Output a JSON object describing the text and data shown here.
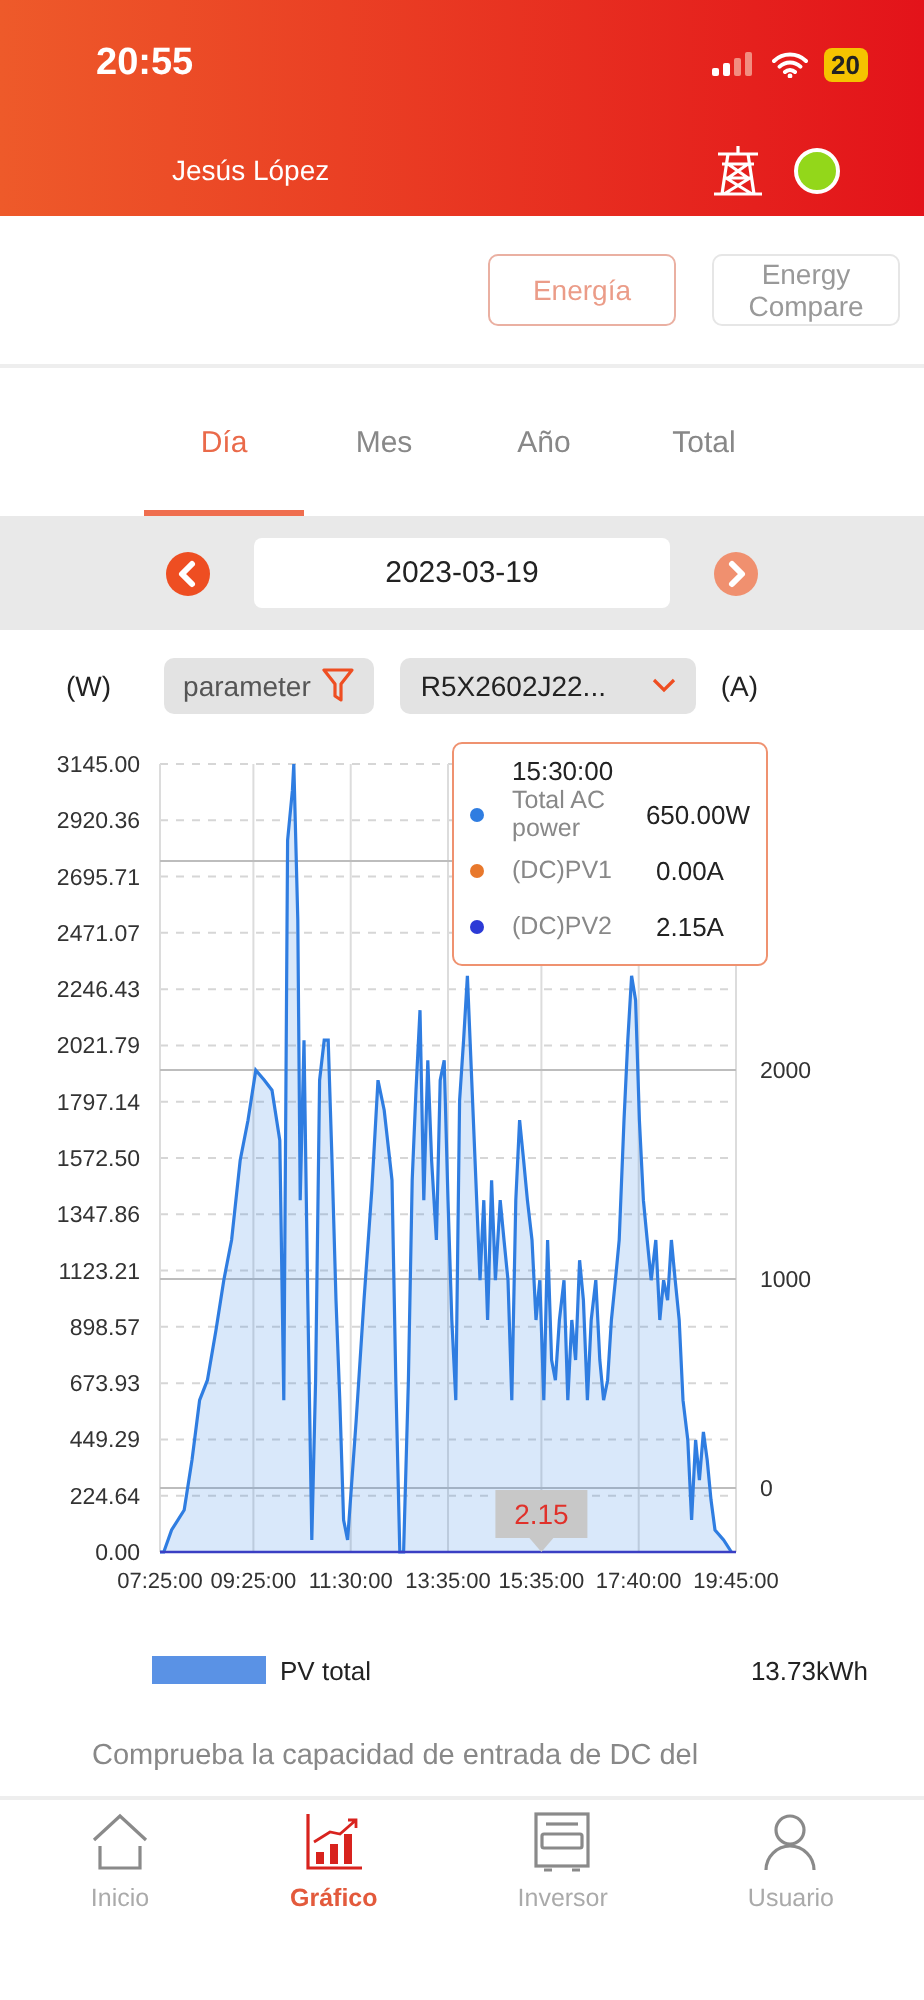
{
  "status_bar": {
    "time": "20:55",
    "battery": "20"
  },
  "header": {
    "user": "Jesús López"
  },
  "view_buttons": [
    {
      "label": "Energía",
      "selected": true
    },
    {
      "label": "Energy Compare",
      "selected": false
    }
  ],
  "period_tabs": [
    {
      "label": "Día",
      "selected": true
    },
    {
      "label": "Mes",
      "selected": false
    },
    {
      "label": "Año",
      "selected": false
    },
    {
      "label": "Total",
      "selected": false
    }
  ],
  "date_bar": {
    "date": "2023-03-19"
  },
  "filters": {
    "left_unit": "(W)",
    "parameter": "parameter",
    "device": "R5X2602J22...",
    "right_unit": "(A)"
  },
  "chart": {
    "chart_data": {
      "type": "area",
      "grid": true,
      "xlim": [
        445,
        1185
      ],
      "ylim": [
        0,
        3145
      ],
      "xticks": [
        {
          "value": 445,
          "label": "07:25:00"
        },
        {
          "value": 565,
          "label": "09:25:00"
        },
        {
          "value": 690,
          "label": "11:30:00"
        },
        {
          "value": 815,
          "label": "13:35:00"
        },
        {
          "value": 935,
          "label": "15:35:00"
        },
        {
          "value": 1060,
          "label": "17:40:00"
        },
        {
          "value": 1185,
          "label": "19:45:00"
        }
      ],
      "yticks": [
        {
          "value": 0,
          "label": "0.00"
        },
        {
          "value": 224.64,
          "label": "224.64"
        },
        {
          "value": 449.29,
          "label": "449.29"
        },
        {
          "value": 673.93,
          "label": "673.93"
        },
        {
          "value": 898.57,
          "label": "898.57"
        },
        {
          "value": 1123.21,
          "label": "1123.21"
        },
        {
          "value": 1347.86,
          "label": "1347.86"
        },
        {
          "value": 1572.5,
          "label": "1572.50"
        },
        {
          "value": 1797.14,
          "label": "1797.14"
        },
        {
          "value": 2021.79,
          "label": "2021.79"
        },
        {
          "value": 2246.43,
          "label": "2246.43"
        },
        {
          "value": 2471.07,
          "label": "2471.07"
        },
        {
          "value": 2695.71,
          "label": "2695.71"
        },
        {
          "value": 2920.36,
          "label": "2920.36"
        },
        {
          "value": 3145,
          "label": "3145.00"
        }
      ],
      "x": [
        445,
        450,
        460,
        476,
        486,
        496,
        506,
        517,
        527,
        537,
        548,
        558,
        568,
        579,
        589,
        599,
        604,
        609,
        615,
        617,
        622,
        625,
        630,
        635,
        640,
        645,
        650,
        656,
        661,
        666,
        671,
        676,
        681,
        686,
        697,
        707,
        717,
        725,
        733,
        743,
        748,
        753,
        758,
        764,
        769,
        774,
        779,
        784,
        789,
        794,
        800,
        805,
        810,
        815,
        820,
        825,
        830,
        835,
        840,
        856,
        861,
        866,
        871,
        876,
        882,
        887,
        892,
        897,
        902,
        907,
        912,
        917,
        923,
        928,
        933,
        938,
        943,
        948,
        953,
        958,
        964,
        969,
        974,
        979,
        984,
        989,
        994,
        999,
        1005,
        1010,
        1015,
        1020,
        1025,
        1030,
        1035,
        1041,
        1046,
        1051,
        1056,
        1061,
        1066,
        1071,
        1076,
        1082,
        1087,
        1092,
        1097,
        1102,
        1107,
        1112,
        1117,
        1123,
        1128,
        1133,
        1138,
        1143,
        1148,
        1153,
        1158,
        1169,
        1179
      ],
      "series": [
        {
          "name": "Total AC power",
          "color": "#2f7de1",
          "values": [
            0,
            0,
            88,
            168,
            367,
            606,
            686,
            886,
            1085,
            1245,
            1564,
            1723,
            1923,
            1883,
            1843,
            1643,
            606,
            2840,
            3040,
            3145,
            2522,
            1404,
            2043,
            1005,
            48,
            686,
            1883,
            2043,
            2043,
            1564,
            1005,
            606,
            128,
            48,
            527,
            1005,
            1444,
            1883,
            1763,
            1484,
            686,
            0,
            0,
            686,
            1484,
            1843,
            2162,
            1404,
            1963,
            1564,
            1245,
            1883,
            1963,
            1404,
            927,
            606,
            1803,
            2043,
            2300,
            1085,
            1404,
            926,
            1484,
            1085,
            1404,
            1245,
            1085,
            606,
            1404,
            1723,
            1564,
            1404,
            1245,
            926,
            1085,
            606,
            1245,
            766,
            686,
            926,
            1085,
            606,
            926,
            766,
            1165,
            1005,
            606,
            926,
            1085,
            766,
            606,
            686,
            926,
            1085,
            1245,
            1723,
            2043,
            2300,
            2202,
            1723,
            1404,
            1245,
            1085,
            1245,
            926,
            1085,
            1005,
            1245,
            1085,
            926,
            606,
            447,
            128,
            447,
            287,
            479,
            367,
            208,
            88,
            48,
            0
          ]
        }
      ],
      "annotations": [
        {
          "x": 935,
          "y": 0,
          "text": "2.15"
        }
      ]
    },
    "right_axis_ticks": [
      "2000",
      "1000",
      "0"
    ],
    "tooltip": {
      "time": "15:30:00",
      "rows": [
        {
          "value": "650.00W",
          "color": "#2f7de1"
        },
        {
          "label": "(DC)PV1",
          "value": "0.00A",
          "color": "#e8782c"
        },
        {
          "label": "(DC)PV2",
          "value": "2.15A",
          "color": "#2c3ad6"
        }
      ]
    }
  },
  "legend": {
    "label": "PV total",
    "total": "13.73kWh"
  },
  "note": "Comprueba la capacidad de entrada de DC del",
  "nav": [
    {
      "label": "Inicio",
      "selected": false
    },
    {
      "label": "Gráfico",
      "selected": true
    },
    {
      "label": "Inversor",
      "selected": false
    },
    {
      "label": "Usuario",
      "selected": false
    }
  ]
}
